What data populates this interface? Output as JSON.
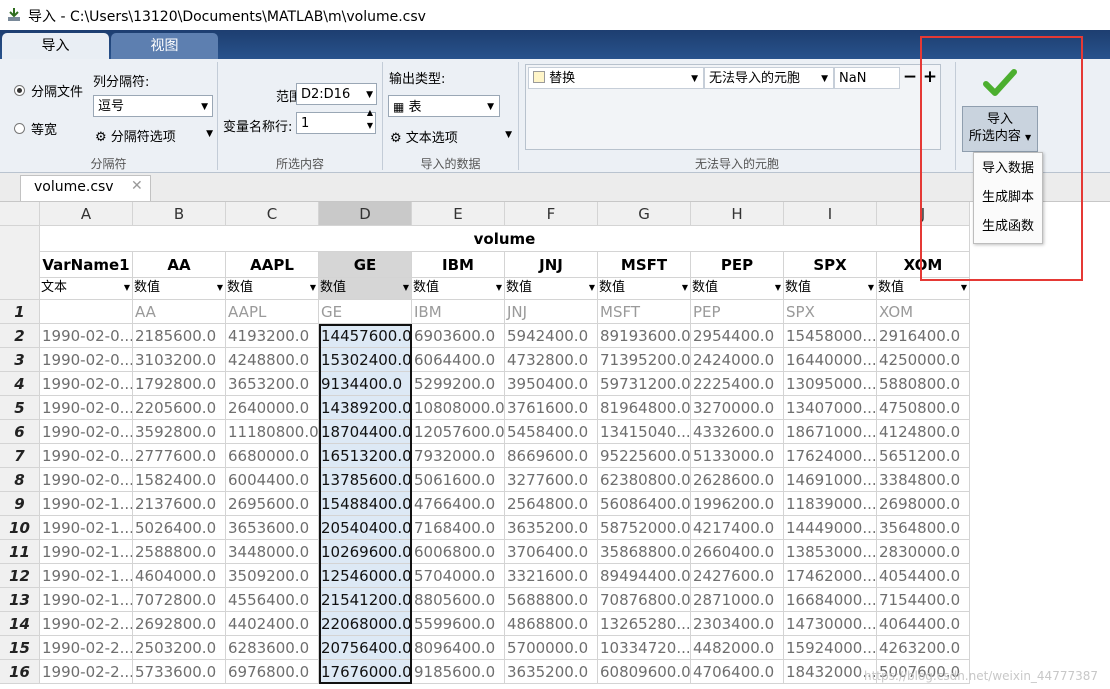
{
  "window": {
    "title": "导入 - C:\\Users\\13120\\Documents\\MATLAB\\m\\volume.csv"
  },
  "ribbon": {
    "tabs": [
      "导入",
      "视图"
    ],
    "delimiters": {
      "radio_delimited": "分隔文件",
      "radio_fixed": "等宽",
      "col_delim_label": "列分隔符:",
      "col_delim_value": "逗号",
      "delim_options": "分隔符选项",
      "section": "分隔符"
    },
    "selection": {
      "range_label": "范围:",
      "range_value": "D2:D16",
      "varnames_label": "变量名称行:",
      "varnames_value": "1",
      "section": "所选内容"
    },
    "imported": {
      "output_type_label": "输出类型:",
      "output_type_value": "表",
      "text_options": "文本选项",
      "section": "导入的数据"
    },
    "unimportable": {
      "rule_action": "替换",
      "rule_target": "无法导入的元胞",
      "rule_value": "NaN",
      "section": "无法导入的元胞"
    },
    "import_button": {
      "line1": "导入",
      "line2": "所选内容"
    },
    "import_menu": [
      "导入数据",
      "生成脚本",
      "生成函数"
    ]
  },
  "file_tab": "volume.csv",
  "grid": {
    "col_letters": [
      "A",
      "B",
      "C",
      "D",
      "E",
      "F",
      "G",
      "H",
      "I",
      "J"
    ],
    "group_title": "volume",
    "var_names": [
      "VarName1",
      "AA",
      "AAPL",
      "GE",
      "IBM",
      "JNJ",
      "MSFT",
      "PEP",
      "SPX",
      "XOM"
    ],
    "types": [
      "文本",
      "数值",
      "数值",
      "数值",
      "数值",
      "数值",
      "数值",
      "数值",
      "数值",
      "数值"
    ],
    "original_names": [
      "",
      "AA",
      "AAPL",
      "GE",
      "IBM",
      "JNJ",
      "MSFT",
      "PEP",
      "SPX",
      "XOM"
    ],
    "rows": [
      [
        "1990-02-0...",
        "2185600.0",
        "4193200.0",
        "14457600.0",
        "6903600.0",
        "5942400.0",
        "89193600.0",
        "2954400.0",
        "15458000...",
        "2916400.0"
      ],
      [
        "1990-02-0...",
        "3103200.0",
        "4248800.0",
        "15302400.0",
        "6064400.0",
        "4732800.0",
        "71395200.0",
        "2424000.0",
        "16440000...",
        "4250000.0"
      ],
      [
        "1990-02-0...",
        "1792800.0",
        "3653200.0",
        "9134400.0",
        "5299200.0",
        "3950400.0",
        "59731200.0",
        "2225400.0",
        "13095000...",
        "5880800.0"
      ],
      [
        "1990-02-0...",
        "2205600.0",
        "2640000.0",
        "14389200.0",
        "10808000.0",
        "3761600.0",
        "81964800.0",
        "3270000.0",
        "13407000...",
        "4750800.0"
      ],
      [
        "1990-02-0...",
        "3592800.0",
        "11180800.0",
        "18704400.0",
        "12057600.0",
        "5458400.0",
        "13415040...",
        "4332600.0",
        "18671000...",
        "4124800.0"
      ],
      [
        "1990-02-0...",
        "2777600.0",
        "6680000.0",
        "16513200.0",
        "7932000.0",
        "8669600.0",
        "95225600.0",
        "5133000.0",
        "17624000...",
        "5651200.0"
      ],
      [
        "1990-02-0...",
        "1582400.0",
        "6004400.0",
        "13785600.0",
        "5061600.0",
        "3277600.0",
        "62380800.0",
        "2628600.0",
        "14691000...",
        "3384800.0"
      ],
      [
        "1990-02-1...",
        "2137600.0",
        "2695600.0",
        "15488400.0",
        "4766400.0",
        "2564800.0",
        "56086400.0",
        "1996200.0",
        "11839000...",
        "2698000.0"
      ],
      [
        "1990-02-1...",
        "5026400.0",
        "3653600.0",
        "20540400.0",
        "7168400.0",
        "3635200.0",
        "58752000.0",
        "4217400.0",
        "14449000...",
        "3564800.0"
      ],
      [
        "1990-02-1...",
        "2588800.0",
        "3448000.0",
        "10269600.0",
        "6006800.0",
        "3706400.0",
        "35868800.0",
        "2660400.0",
        "13853000...",
        "2830000.0"
      ],
      [
        "1990-02-1...",
        "4604000.0",
        "3509200.0",
        "12546000.0",
        "5704000.0",
        "3321600.0",
        "89494400.0",
        "2427600.0",
        "17462000...",
        "4054400.0"
      ],
      [
        "1990-02-1...",
        "7072800.0",
        "4556400.0",
        "21541200.0",
        "8805600.0",
        "5688800.0",
        "70876800.0",
        "2871000.0",
        "16684000...",
        "7154400.0"
      ],
      [
        "1990-02-2...",
        "2692800.0",
        "4402400.0",
        "22068000.0",
        "5599600.0",
        "4868800.0",
        "13265280...",
        "2303400.0",
        "14730000...",
        "4064400.0"
      ],
      [
        "1990-02-2...",
        "2503200.0",
        "6283600.0",
        "20756400.0",
        "8096400.0",
        "5700000.0",
        "10334720...",
        "4482000.0",
        "15924000...",
        "4263200.0"
      ],
      [
        "1990-02-2...",
        "5733600.0",
        "6976800.0",
        "17676000.0",
        "9185600.0",
        "3635200.0",
        "60809600.0",
        "4706400.0",
        "18432000...",
        "5007600.0"
      ]
    ]
  },
  "watermark": "https://blog.csdn.net/weixin_44777387",
  "colors": {
    "ribbon_blue": "#1d3e70",
    "highlight_red": "#e53935",
    "selected_col": "#dde9f5"
  }
}
